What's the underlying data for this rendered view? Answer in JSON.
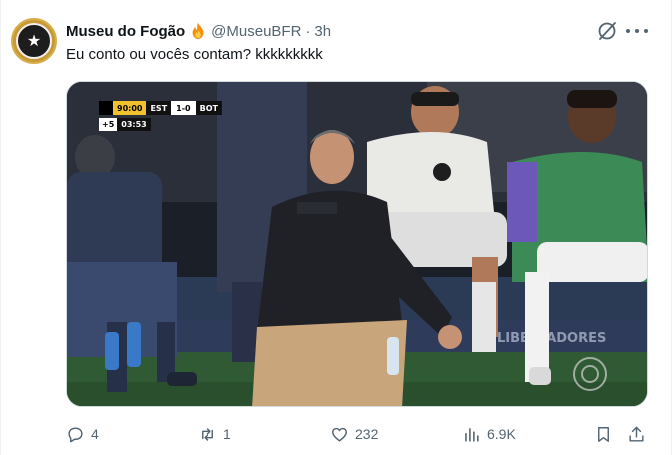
{
  "tweet": {
    "author": {
      "display_name": "Museu do Fogão",
      "handle": "@MuseuBFR",
      "separator": "·",
      "time": "3h",
      "badge_icon": "fire-icon"
    },
    "text": "Eu conto ou vocês contam? kkkkkkkkk",
    "media": {
      "scorebug": {
        "time": "90:00",
        "home": "EST",
        "score": "1-0",
        "away": "BOT",
        "added_time": "+5",
        "clock": "03:53"
      },
      "ad_board_text": "LIBERTADORES"
    },
    "actions": {
      "replies": "4",
      "reposts": "1",
      "likes": "232",
      "views": "6.9K"
    }
  },
  "colors": {
    "text_primary": "#0f1419",
    "text_secondary": "#536471",
    "border": "#cfd9de",
    "scorebug_yellow": "#f2c12e"
  }
}
